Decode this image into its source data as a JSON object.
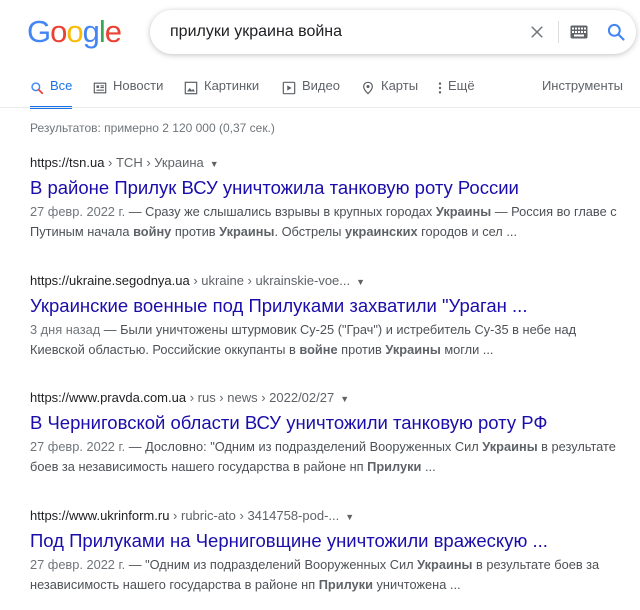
{
  "logo": {
    "letters": [
      "G",
      "o",
      "o",
      "g",
      "l",
      "e"
    ],
    "colors": [
      "#4285f4",
      "#ea4335",
      "#fbbc05",
      "#4285f4",
      "#34a853",
      "#ea4335"
    ]
  },
  "search": {
    "query": "прилуки украина война"
  },
  "tabs": [
    {
      "label": "Все",
      "icon": "search-icon",
      "active": true
    },
    {
      "label": "Новости",
      "icon": "news-icon"
    },
    {
      "label": "Картинки",
      "icon": "image-icon"
    },
    {
      "label": "Видео",
      "icon": "video-icon"
    },
    {
      "label": "Карты",
      "icon": "map-pin-icon"
    },
    {
      "label": "Ещё",
      "icon": "more-icon"
    }
  ],
  "tools_label": "Инструменты",
  "stats": "Результатов: примерно 2 120 000 (0,37 сек.)",
  "results": [
    {
      "site": "https://tsn.ua",
      "crumbs": " › ТСН › Украина",
      "title": "В районе Прилук ВСУ уничтожила танковую роту России",
      "date": "27 февр. 2022 г.",
      "snippet_html": "Сразу же слышались взрывы в крупных городах <b>Украины</b> — Россия во главе с Путиным начала <b>войну</b> против <b>Украины</b>. Обстрелы <b>украинских</b> городов и сел ..."
    },
    {
      "site": "https://ukraine.segodnya.ua",
      "crumbs": " › ukraine › ukrainskie-voe...",
      "title": "Украинские военные под Прилуками захватили \"Ураган ...",
      "date": "3 дня назад",
      "snippet_html": "Были уничтожены штурмовик Су-25 (\"Грач\") и истребитель Су-35 в небе над Киевской областью. Российские оккупанты в <b>войне</b> против <b>Украины</b> могли ..."
    },
    {
      "site": "https://www.pravda.com.ua",
      "crumbs": " › rus › news › 2022/02/27",
      "title": "В Черниговской области ВСУ уничтожили танковую роту РФ",
      "date": "27 февр. 2022 г.",
      "snippet_html": "Дословно: \"Одним из подразделений Вооруженных Сил <b>Украины</b> в результате боев за независимость нашего государства в районе нп <b>Прилуки</b> ..."
    },
    {
      "site": "https://www.ukrinform.ru",
      "crumbs": " › rubric-ato › 3414758-pod-...",
      "title": "Под Прилуками на Черниговщине уничтожили вражескую ...",
      "date": "27 февр. 2022 г.",
      "snippet_html": "\"Одним из подразделений Вооруженных Сил <b>Украины</b> в результате боев за независимость нашего государства в районе нп <b>Прилуки</b> уничтожена ..."
    }
  ]
}
